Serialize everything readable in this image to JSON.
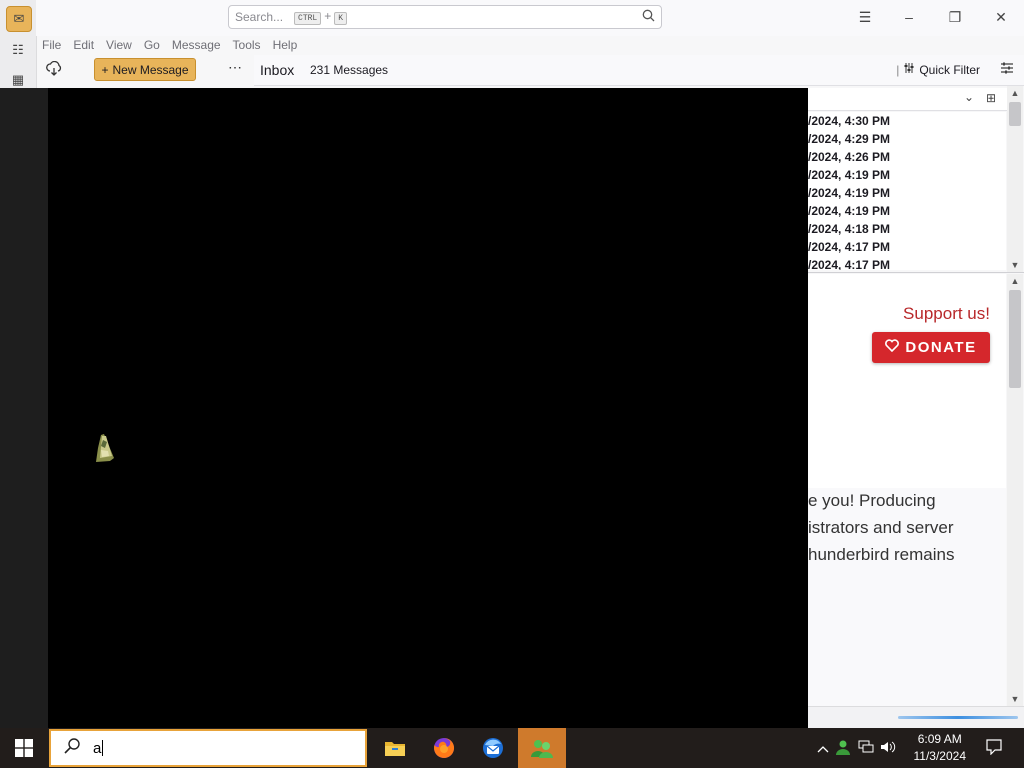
{
  "app": {
    "search_placeholder": "Search...",
    "search_key_1": "CTRL",
    "search_key_sep": "+",
    "search_key_2": "K",
    "menu": [
      "File",
      "Edit",
      "View",
      "Go",
      "Message",
      "Tools",
      "Help"
    ],
    "new_message_label": "New Message",
    "folder_name": "Inbox",
    "message_count": "231 Messages",
    "quick_filter_label": "Quick Filter"
  },
  "thread_list": {
    "dates": [
      "/2024, 4:30 PM",
      "/2024, 4:29 PM",
      "/2024, 4:26 PM",
      "/2024, 4:19 PM",
      "/2024, 4:19 PM",
      "/2024, 4:19 PM",
      "/2024, 4:18 PM",
      "/2024, 4:17 PM",
      "/2024, 4:17 PM"
    ]
  },
  "preview": {
    "support_text": "Support us!",
    "donate_label": "DONATE",
    "appeal_lines": [
      "e you! Producing",
      "istrators and server",
      "hunderbird remains"
    ]
  },
  "taskbar": {
    "search_value": "a",
    "apps": [
      "file-explorer",
      "firefox",
      "thunderbird",
      "game-app"
    ],
    "time": "6:09 AM",
    "date": "11/3/2024"
  },
  "colors": {
    "accent": "#e8b45a",
    "donate": "#d5272c",
    "support_text": "#b8282a",
    "taskbar": "#221d1b",
    "taskbar_active": "#cf7a2c"
  }
}
